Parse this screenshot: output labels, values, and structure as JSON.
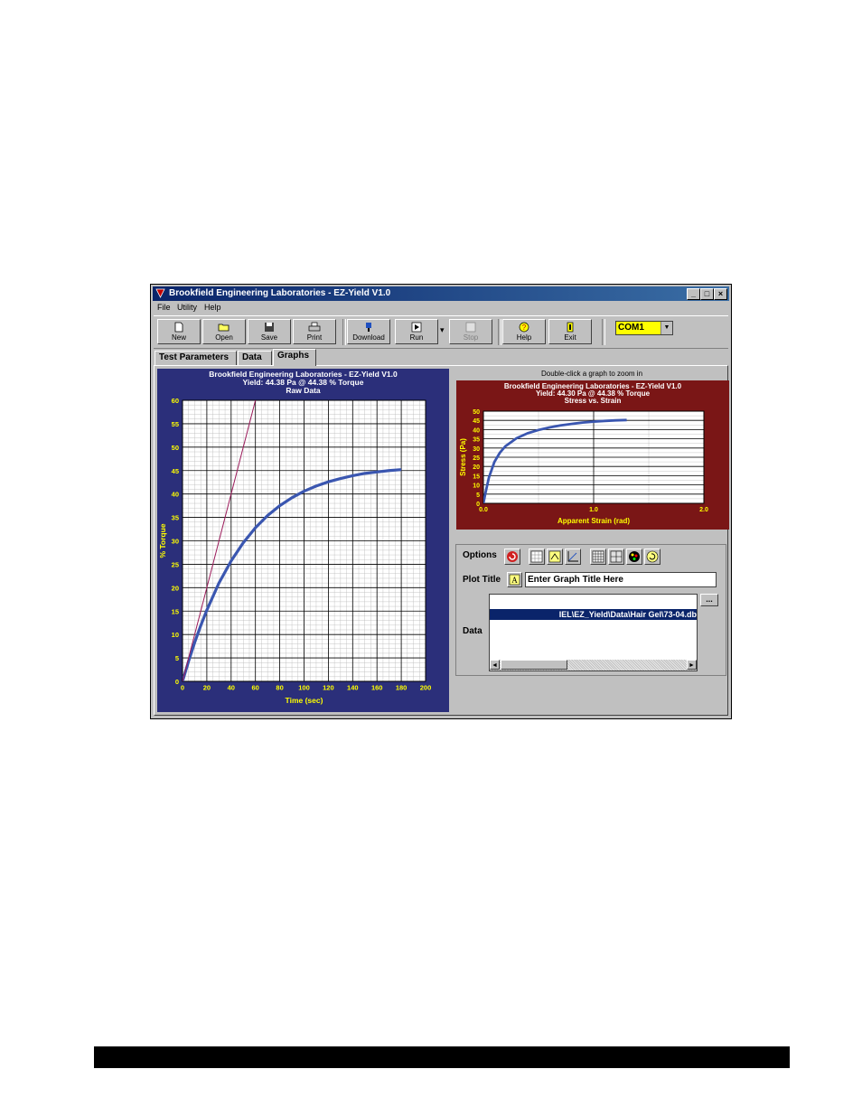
{
  "window": {
    "title": "Brookfield Engineering Laboratories  -  EZ-Yield V1.0",
    "minimize": "_",
    "maximize": "□",
    "close": "×"
  },
  "menu": [
    "File",
    "Utility",
    "Help"
  ],
  "toolbar": {
    "buttons": [
      {
        "label": "New",
        "icon": "new-file-icon"
      },
      {
        "label": "Open",
        "icon": "open-folder-icon"
      },
      {
        "label": "Save",
        "icon": "save-icon"
      },
      {
        "label": "Print",
        "icon": "printer-icon"
      },
      {
        "label": "Download",
        "icon": "download-icon"
      },
      {
        "label": "Run",
        "icon": "run-icon"
      },
      {
        "label": "Stop",
        "icon": "stop-icon"
      },
      {
        "label": "Help",
        "icon": "help-icon"
      },
      {
        "label": "Exit",
        "icon": "exit-door-icon"
      }
    ],
    "port": "COM1",
    "dropdown_arrow": "▼",
    "run_arrow": "▾"
  },
  "tabs": [
    "Test Parameters",
    "Data",
    "Graphs"
  ],
  "hint": "Double-click a graph to zoom in",
  "options": {
    "label": "Options",
    "plot_title_label": "Plot Title",
    "plot_title_value": "Enter Graph Title Here",
    "data_label": "Data",
    "data_file": "IEL\\EZ_Yield\\Data\\Hair Gel\\73-04.db",
    "ellipsis": "...",
    "scroll_left": "◄",
    "scroll_right": "►"
  },
  "chart_data": [
    {
      "type": "line",
      "title": "Brookfield Engineering Laboratories  -  EZ-Yield V1.0",
      "subtitle": "Yield: 44.38 Pa @ 44.38 % Torque",
      "subtitle2": "Raw Data",
      "xlabel": "Time (sec)",
      "ylabel": "% Torque",
      "xlim": [
        0,
        200
      ],
      "ylim": [
        0,
        60
      ],
      "xticks": [
        0,
        20,
        40,
        60,
        80,
        100,
        120,
        140,
        160,
        180,
        200
      ],
      "yticks": [
        0,
        5,
        10,
        15,
        20,
        25,
        30,
        35,
        40,
        45,
        50,
        55,
        60
      ],
      "grid": true,
      "background": "#2b2f7a",
      "label_color": "#ffff00",
      "series": [
        {
          "color": "#3a56b0",
          "x": [
            0,
            5,
            10,
            15,
            20,
            30,
            40,
            50,
            60,
            70,
            80,
            90,
            100,
            110,
            120,
            130,
            140,
            150,
            160,
            170,
            180
          ],
          "y": [
            0,
            4.3,
            8.3,
            11.9,
            15.2,
            21.0,
            25.7,
            29.6,
            32.8,
            35.4,
            37.5,
            39.2,
            40.6,
            41.7,
            42.6,
            43.3,
            43.9,
            44.4,
            44.7,
            45.0,
            45.2
          ]
        },
        {
          "color": "#9b1a5a",
          "x": [
            0,
            60
          ],
          "y": [
            0,
            60
          ]
        }
      ]
    },
    {
      "type": "line",
      "title": "Brookfield Engineering Laboratories  -  EZ-Yield V1.0",
      "subtitle": "Yield: 44.30 Pa @ 44.38 % Torque",
      "subtitle2": "Stress vs. Strain",
      "xlabel": "Apparent Strain (rad)",
      "ylabel": "Stress (Pa)",
      "xlim": [
        0,
        2.0
      ],
      "ylim": [
        0,
        50
      ],
      "xticks": [
        "0.0",
        "1.0",
        "2.0"
      ],
      "yticks": [
        0,
        5,
        10,
        15,
        20,
        25,
        30,
        35,
        40,
        45,
        50
      ],
      "grid": true,
      "background": "#7a1616",
      "label_color": "#ffff00",
      "series": [
        {
          "color": "#3a56b0",
          "x": [
            0,
            0.02,
            0.05,
            0.1,
            0.15,
            0.2,
            0.3,
            0.4,
            0.5,
            0.6,
            0.7,
            0.8,
            0.9,
            1.0,
            1.1,
            1.2,
            1.3
          ],
          "y": [
            0,
            6,
            14,
            22.5,
            27.5,
            31,
            35.3,
            38,
            39.8,
            41.2,
            42.3,
            43.1,
            43.8,
            44.3,
            44.7,
            45.0,
            45.2
          ]
        }
      ]
    }
  ]
}
